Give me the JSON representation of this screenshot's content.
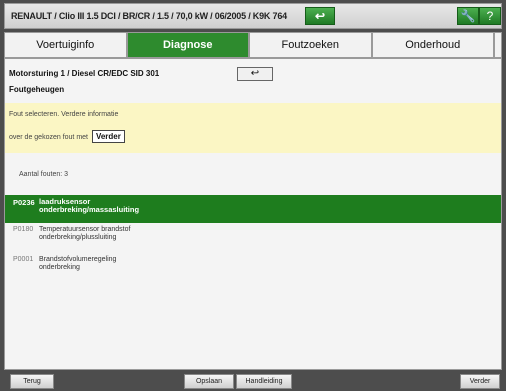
{
  "header": {
    "title": "RENAULT / Clio III 1.5 DCI / BR/CR / 1.5 / 70,0 kW / 06/2005  / K9K 764",
    "back_icon": "undo-arrow-icon",
    "tool_icon": "wrench-icon",
    "help_icon": "?"
  },
  "tabs": [
    {
      "label": "Voertuiginfo",
      "active": false
    },
    {
      "label": "Diagnose",
      "active": true
    },
    {
      "label": "Foutzoeken",
      "active": false
    },
    {
      "label": "Onderhoud",
      "active": false
    }
  ],
  "main": {
    "module": "Motorsturing 1 / Diesel CR/EDC SID 301",
    "section": "Foutgeheugen",
    "nav_back_glyph": "↩",
    "info_line1": "Fout selecteren. Verdere informatie",
    "info_line2": "over de gekozen fout met",
    "info_button": "Verder",
    "count_label": "Aantal fouten: 3",
    "faults": [
      {
        "code": "P0236",
        "line1": "laadruksensor",
        "line2": "onderbreking/massasluiting",
        "selected": true
      },
      {
        "code": "P0180",
        "line1": "Temperatuursensor brandstof",
        "line2": "onderbreking/plussluiting",
        "selected": false
      },
      {
        "code": "P0001",
        "line1": "Brandstofvolumeregeling",
        "line2": "onderbreking",
        "selected": false
      }
    ]
  },
  "footer": {
    "back": "Terug",
    "options": "Opslaan",
    "manual": "Handleiding",
    "next": "Verder"
  },
  "colors": {
    "accent": "#2e8b2e",
    "selected_row": "#1e7d1e",
    "info_bg": "#fbf6c4"
  }
}
